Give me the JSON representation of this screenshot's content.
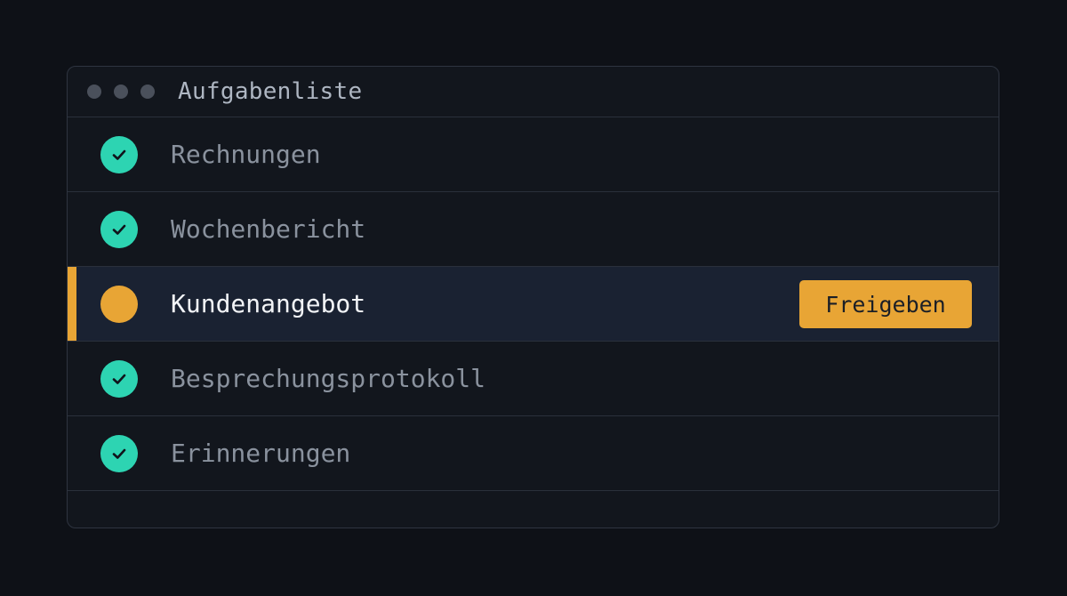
{
  "window": {
    "title": "Aufgabenliste"
  },
  "tasks": [
    {
      "label": "Rechnungen",
      "status": "done"
    },
    {
      "label": "Wochenbericht",
      "status": "done"
    },
    {
      "label": "Kundenangebot",
      "status": "pending",
      "action_label": "Freigeben"
    },
    {
      "label": "Besprechungsprotokoll",
      "status": "done"
    },
    {
      "label": "Erinnerungen",
      "status": "done"
    }
  ],
  "colors": {
    "done": "#2dd4b2",
    "pending_accent": "#e8a535",
    "background": "#0e1117",
    "panel": "#12161d"
  },
  "icons": {
    "done": "check-circle-icon",
    "pending": "pending-circle-icon"
  }
}
